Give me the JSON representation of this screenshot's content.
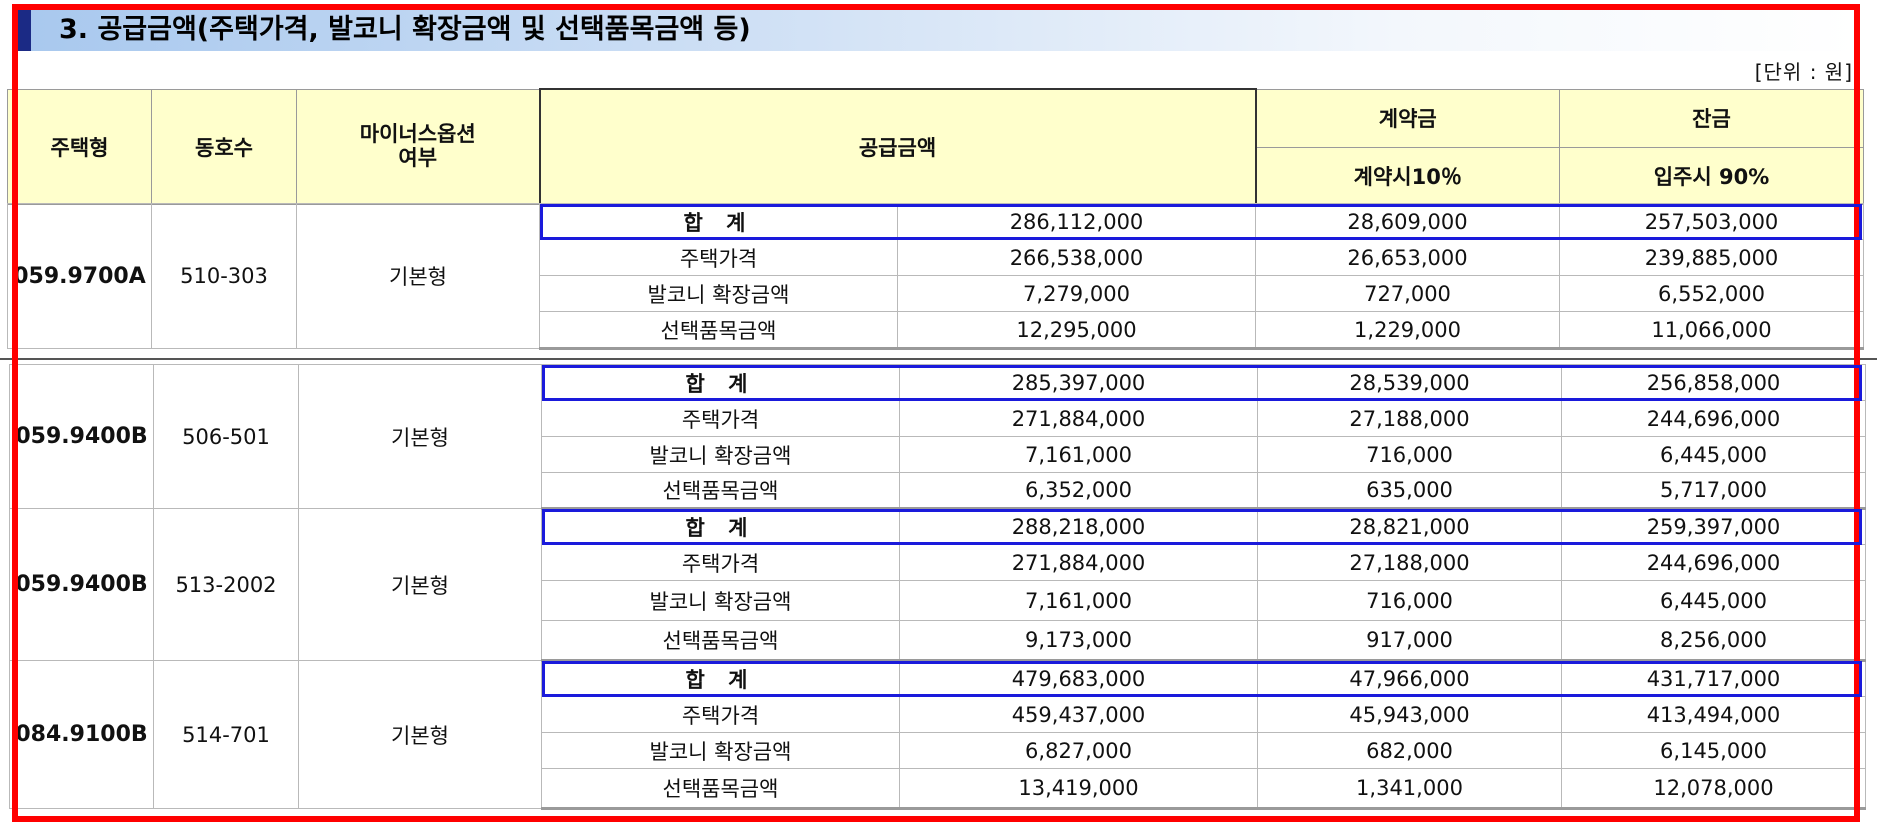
{
  "section_title": "3. 공급금액(주택가격, 발코니 확장금액 및 선택품목금액 등)",
  "unit_label": "[단위 : 원]",
  "header": {
    "house_type": "주택형",
    "unit_no": "동호수",
    "minus_option": "마이너스옵션\n여부",
    "supply_amount": "공급금액",
    "deposit": "계약금",
    "deposit_sub": "계약시10％",
    "balance": "잔금",
    "balance_sub": "입주시 90%"
  },
  "groups": [
    {
      "type": "059.9700A",
      "unit": "510-303",
      "option": "기본형",
      "rows": [
        {
          "label": "합 계",
          "supply": "286,112,000",
          "deposit": "28,609,000",
          "balance": "257,503,000"
        },
        {
          "label": "주택가격",
          "supply": "266,538,000",
          "deposit": "26,653,000",
          "balance": "239,885,000"
        },
        {
          "label": "발코니 확장금액",
          "supply": "7,279,000",
          "deposit": "727,000",
          "balance": "6,552,000"
        },
        {
          "label": "선택품목금액",
          "supply": "12,295,000",
          "deposit": "1,229,000",
          "balance": "11,066,000"
        }
      ]
    },
    {
      "type": "059.9400B",
      "unit": "506-501",
      "option": "기본형",
      "rows": [
        {
          "label": "합 계",
          "supply": "285,397,000",
          "deposit": "28,539,000",
          "balance": "256,858,000"
        },
        {
          "label": "주택가격",
          "supply": "271,884,000",
          "deposit": "27,188,000",
          "balance": "244,696,000"
        },
        {
          "label": "발코니 확장금액",
          "supply": "7,161,000",
          "deposit": "716,000",
          "balance": "6,445,000"
        },
        {
          "label": "선택품목금액",
          "supply": "6,352,000",
          "deposit": "635,000",
          "balance": "5,717,000"
        }
      ]
    },
    {
      "type": "059.9400B",
      "unit": "513-2002",
      "option": "기본형",
      "rows": [
        {
          "label": "합 계",
          "supply": "288,218,000",
          "deposit": "28,821,000",
          "balance": "259,397,000"
        },
        {
          "label": "주택가격",
          "supply": "271,884,000",
          "deposit": "27,188,000",
          "balance": "244,696,000"
        },
        {
          "label": "발코니 확장금액",
          "supply": "7,161,000",
          "deposit": "716,000",
          "balance": "6,445,000"
        },
        {
          "label": "선택품목금액",
          "supply": "9,173,000",
          "deposit": "917,000",
          "balance": "8,256,000"
        }
      ]
    },
    {
      "type": "084.9100B",
      "unit": "514-701",
      "option": "기본형",
      "rows": [
        {
          "label": "합 계",
          "supply": "479,683,000",
          "deposit": "47,966,000",
          "balance": "431,717,000"
        },
        {
          "label": "주택가격",
          "supply": "459,437,000",
          "deposit": "45,943,000",
          "balance": "413,494,000"
        },
        {
          "label": "발코니 확장금액",
          "supply": "6,827,000",
          "deposit": "682,000",
          "balance": "6,145,000"
        },
        {
          "label": "선택품목금액",
          "supply": "13,419,000",
          "deposit": "1,341,000",
          "balance": "12,078,000"
        }
      ]
    }
  ],
  "colors": {
    "header_bg": "#ffffcc",
    "highlight_frame": "#ff0000",
    "total_row_frame": "#1a1adb",
    "title_accent": "#1b2a85"
  }
}
